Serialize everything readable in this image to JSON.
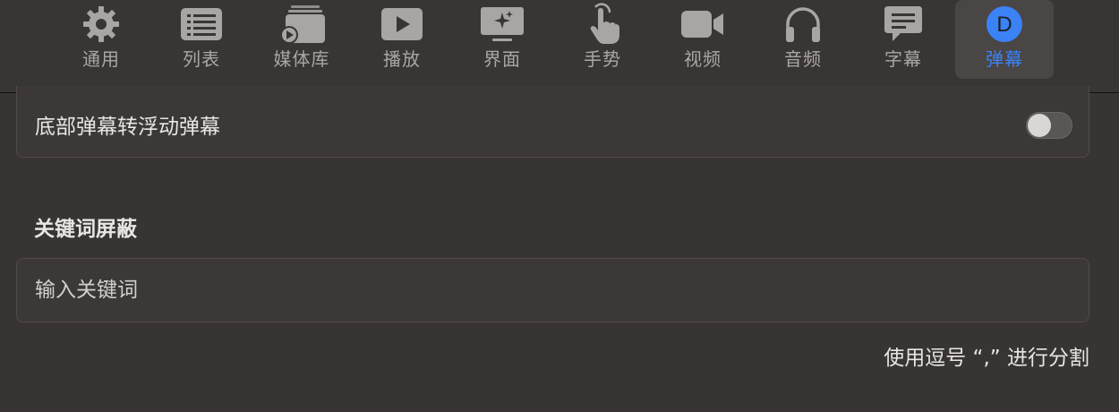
{
  "toolbar": {
    "tabs": [
      {
        "label": "通用",
        "icon": "gear-icon"
      },
      {
        "label": "列表",
        "icon": "list-icon"
      },
      {
        "label": "媒体库",
        "icon": "media-library-icon"
      },
      {
        "label": "播放",
        "icon": "play-icon"
      },
      {
        "label": "界面",
        "icon": "interface-icon"
      },
      {
        "label": "手势",
        "icon": "gesture-icon"
      },
      {
        "label": "视频",
        "icon": "video-camera-icon"
      },
      {
        "label": "音频",
        "icon": "headphones-icon"
      },
      {
        "label": "字幕",
        "icon": "subtitle-icon"
      },
      {
        "label": "弹幕",
        "icon": "danmaku-icon",
        "badge": "D",
        "active": true
      }
    ],
    "active_color": "#3b82f6"
  },
  "settings": {
    "bottom_to_float_label": "底部弹幕转浮动弹幕",
    "bottom_to_float_enabled": false,
    "keyword_section_title": "关键词屏蔽",
    "keyword_placeholder": "输入关键词",
    "keyword_value": "",
    "keyword_hint": "使用逗号 “,” 进行分割"
  }
}
